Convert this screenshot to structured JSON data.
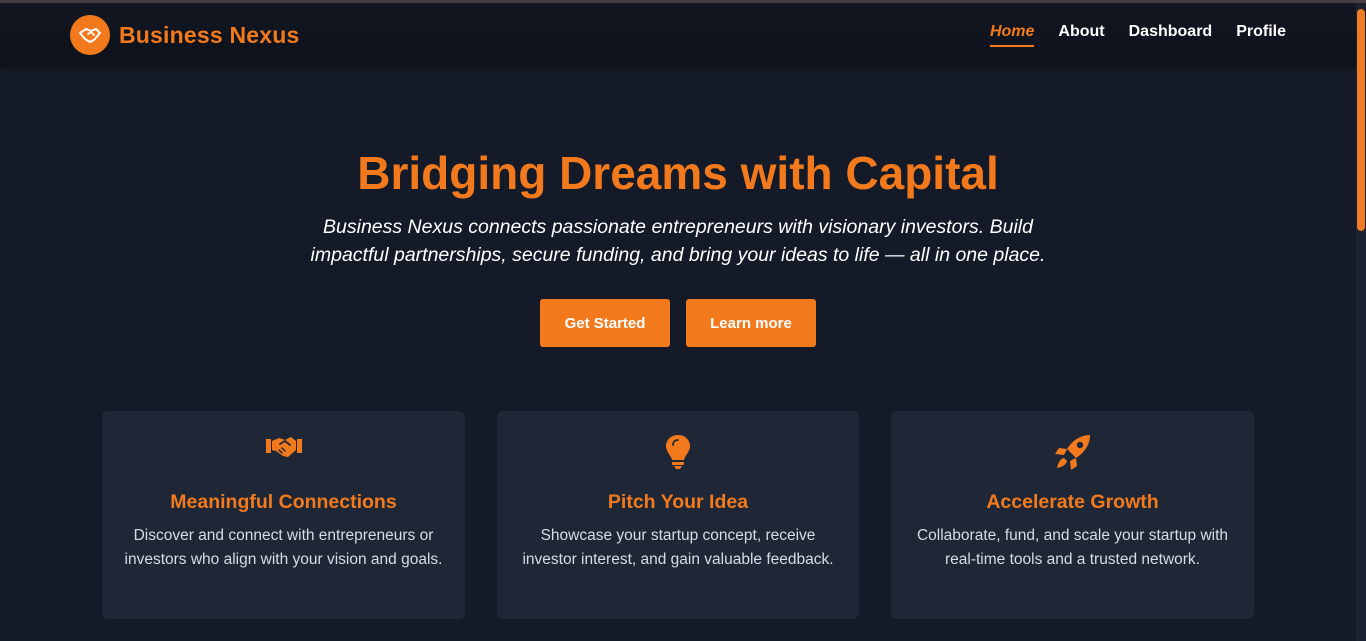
{
  "brand": {
    "name": "Business Nexus",
    "logo_icon": "handshake-icon",
    "accent_color": "#f27a1d"
  },
  "nav": {
    "items": [
      {
        "label": "Home",
        "active": true
      },
      {
        "label": "About",
        "active": false
      },
      {
        "label": "Dashboard",
        "active": false
      },
      {
        "label": "Profile",
        "active": false
      }
    ]
  },
  "hero": {
    "title": "Bridging Dreams with Capital",
    "subtitle": "Business Nexus connects passionate entrepreneurs with visionary investors. Build impactful partnerships, secure funding, and bring your ideas to life — all in one place.",
    "primary_button": "Get Started",
    "secondary_button": "Learn more"
  },
  "features": [
    {
      "icon": "handshake-icon",
      "title": "Meaningful Connections",
      "description": "Discover and connect with entrepreneurs or investors who align with your vision and goals."
    },
    {
      "icon": "lightbulb-icon",
      "title": "Pitch Your Idea",
      "description": "Showcase your startup concept, receive investor interest, and gain valuable feedback."
    },
    {
      "icon": "rocket-icon",
      "title": "Accelerate Growth",
      "description": "Collaborate, fund, and scale your startup with real-time tools and a trusted network."
    }
  ]
}
